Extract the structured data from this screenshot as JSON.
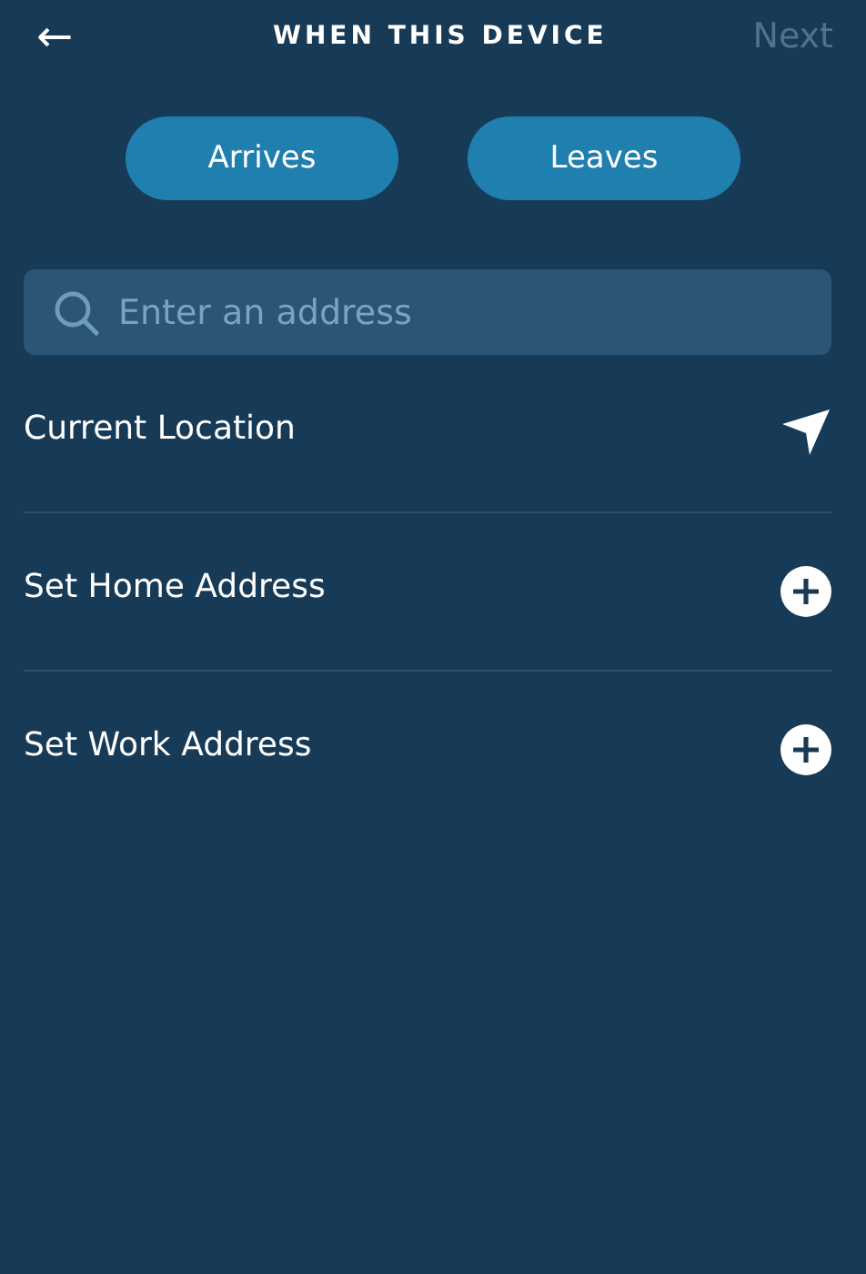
{
  "header": {
    "back": "←",
    "title": "WHEN THIS DEVICE",
    "next": {
      "label": "Next",
      "disabled": true
    }
  },
  "triggers": [
    {
      "label": "Arrives"
    },
    {
      "label": "Leaves"
    }
  ],
  "search": {
    "placeholder": "Enter an address"
  },
  "locations": [
    {
      "label": "Current Location",
      "kind": "location"
    },
    {
      "label": "Set Home Address",
      "kind": "add"
    },
    {
      "label": "Set Work Address",
      "kind": "add"
    }
  ]
}
